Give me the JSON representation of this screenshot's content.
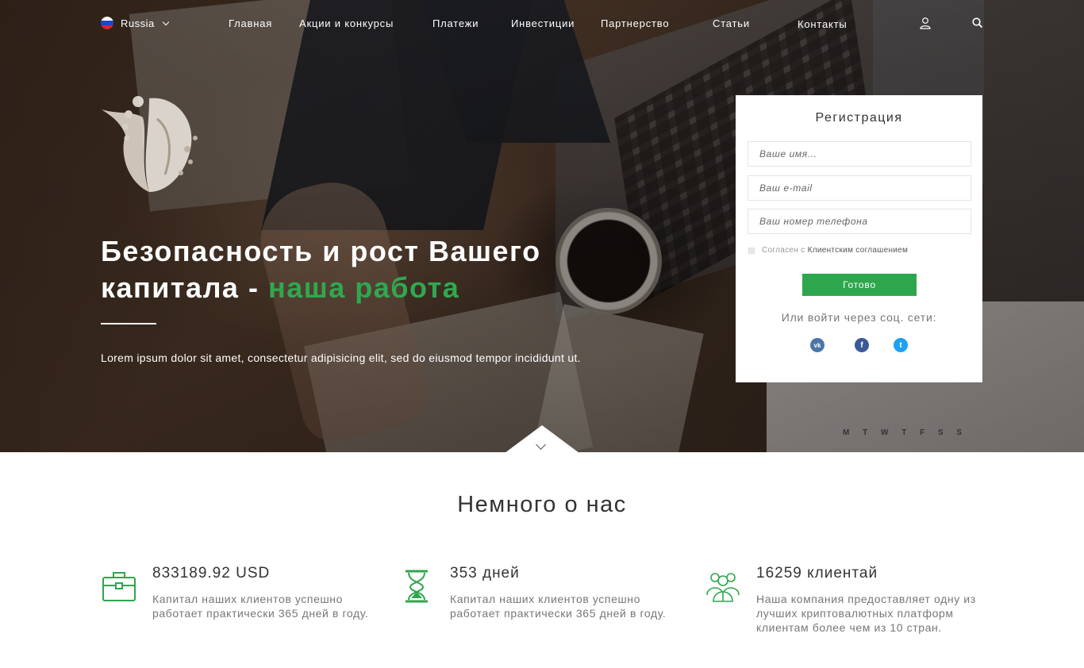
{
  "nav": {
    "language": "Russia",
    "links": [
      "Главная",
      "Акции и конкурсы",
      "Платежи",
      "Инвестиции",
      "Партнерство",
      "Статьи",
      "Контакты"
    ],
    "icons": [
      "user-icon",
      "search-icon"
    ]
  },
  "hero": {
    "headline_main": "Безопасность и рост Вашего капитала - ",
    "headline_accent": "наша работа",
    "lead": "Lorem ipsum dolor sit amet, consectetur adipisicing elit, sed do eiusmod tempor incididunt ut.",
    "calendar_days": "M T W T F S S"
  },
  "registration": {
    "title": "Регистрация",
    "name_placeholder": "Ваше имя...",
    "email_placeholder": "Ваш e-mail",
    "phone_placeholder": "Ваш номер телефона",
    "agree_prefix": "Согласен с",
    "agree_link": "Клиентским соглашением",
    "submit_label": "Готово",
    "social_label": "Или войти через соц. сети:",
    "social": [
      {
        "name": "vk",
        "glyph": "vk",
        "color": "#4a76a8"
      },
      {
        "name": "facebook",
        "glyph": "f",
        "color": "#3b5998"
      },
      {
        "name": "twitter",
        "glyph": "t",
        "color": "#1da1f2"
      }
    ]
  },
  "about": {
    "title": "Немного о нас",
    "stats": [
      {
        "icon": "briefcase-icon",
        "value": "833189.92 USD",
        "description": "Капитал наших клиентов успешно работает практически 365 дней в году."
      },
      {
        "icon": "hourglass-icon",
        "value": "353 дней",
        "description": "Капитал наших клиентов успешно работает практически 365 дней в году."
      },
      {
        "icon": "clients-icon",
        "value": "16259 клиентай",
        "description": "Наша компания предоставляет одну из лучших криптовалютных платформ клиентам более чем из 10 стран."
      }
    ]
  },
  "colors": {
    "accent": "#2ea64d",
    "text": "#333333",
    "muted": "#777777"
  }
}
